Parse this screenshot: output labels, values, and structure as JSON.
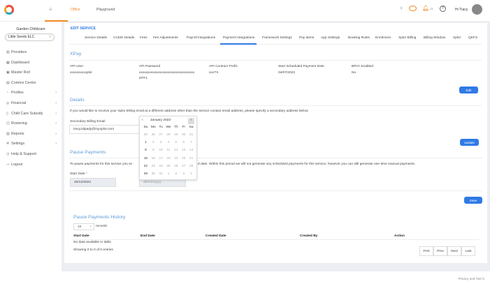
{
  "topbar": {
    "tabs": [
      "Office",
      "Playground"
    ],
    "notification_count": "13",
    "greeting": "Hi Tracy"
  },
  "sidebar": {
    "org": "Garden Childcare",
    "service_select": "Little Seeds ELC",
    "items": [
      {
        "label": "Providers",
        "icon": "building-icon",
        "chevron": false
      },
      {
        "label": "Dashboard",
        "icon": "dashboard-icon",
        "chevron": false
      },
      {
        "label": "Master Roll",
        "icon": "roll-icon",
        "chevron": false
      },
      {
        "label": "Comms Centre",
        "icon": "comms-icon",
        "chevron": false
      },
      {
        "label": "Profiles",
        "icon": "profiles-icon",
        "chevron": true
      },
      {
        "label": "Financial",
        "icon": "financial-icon",
        "chevron": true
      },
      {
        "label": "Child Care Subsidy",
        "icon": "subsidy-icon",
        "chevron": true
      },
      {
        "label": "Rostering",
        "icon": "roster-icon",
        "chevron": true
      },
      {
        "label": "Reports",
        "icon": "reports-icon",
        "chevron": true
      },
      {
        "label": "Settings",
        "icon": "gear-icon",
        "chevron": true
      },
      {
        "label": "Help & Support",
        "icon": "help-icon",
        "chevron": false
      },
      {
        "label": "Logout",
        "icon": "logout-icon",
        "chevron": false
      }
    ]
  },
  "page": {
    "title": "EDIT SERVICE",
    "tabs": [
      "Service Details",
      "CCMS Details",
      "Fees",
      "Fee Adjustments",
      "Payroll Integrations",
      "Payment Integrations",
      "Framework Settings",
      "Pay Items",
      "App Settings",
      "Booking Rules",
      "Enrolment",
      "Xplor Billing",
      "Billing Window",
      "Xplor",
      "QKFS"
    ],
    "active_tab": "Payment Integrations"
  },
  "xpay": {
    "heading": "XPay",
    "fields": [
      {
        "label": "API User",
        "value": "xxxxxxxxxxplor"
      },
      {
        "label": "API Password",
        "value": "xxxxxxxxxxxxxxxxxxxxxxxxxxxxxxxxx",
        "value2": "DFF1"
      },
      {
        "label": "API Contract Prefix",
        "value": "xxxTX"
      },
      {
        "label": "Start Scheduled Payment Date",
        "value": "04/07/2022"
      },
      {
        "label": "BPAY Enabled",
        "value": "No"
      }
    ],
    "edit_label": "Edit"
  },
  "details": {
    "heading": "Details",
    "text": "If you would like to receive your Xplor billing email at a different address other than the service contact email address, please specify a secondary address below.",
    "email_label": "Secondary Billing Email",
    "email_value": "tracy.kilpady@myxplor.com",
    "update_label": "Update"
  },
  "calendar": {
    "month": "January 2023",
    "prev": "‹",
    "weekdays": [
      "Su",
      "Mo",
      "Tu",
      "We",
      "Th",
      "Fr",
      "Sa"
    ],
    "weeks": [
      [
        "25",
        "26",
        "27",
        "28",
        "29",
        "30",
        "31"
      ],
      [
        "1",
        "2",
        "3",
        "4",
        "5",
        "6",
        "7"
      ],
      [
        "8",
        "9",
        "10",
        "11",
        "12",
        "13",
        "14"
      ],
      [
        "15",
        "16",
        "17",
        "18",
        "19",
        "20",
        "21"
      ],
      [
        "22",
        "23",
        "24",
        "25",
        "26",
        "27",
        "28"
      ],
      [
        "29",
        "30",
        "31",
        "1",
        "2",
        "3",
        "4"
      ]
    ]
  },
  "pause": {
    "heading": "Pause Payments",
    "text_a": "To pause payments for this service you wi",
    "text_b": "d date. Within this period we will not generate any scheduled payments for this service, however you can still generate one-time manual payments.",
    "start_label": "Start Date",
    "required": "*",
    "start_value": "26/12/2022",
    "end_placeholder": "dd/mm/yyyy",
    "save_label": "Save"
  },
  "history": {
    "heading": "Pause Payments History",
    "page_size": "10",
    "records_label": "records",
    "columns": [
      "Start Date",
      "End Date",
      "Created Date",
      "Created By",
      "Action"
    ],
    "empty": "No data available in table",
    "showing": "Showing 0 to 0 of 0 entries",
    "pager": [
      "First",
      "Prev",
      "Next",
      "Last"
    ]
  },
  "footer": {
    "link": "Privacy and T&C's"
  }
}
